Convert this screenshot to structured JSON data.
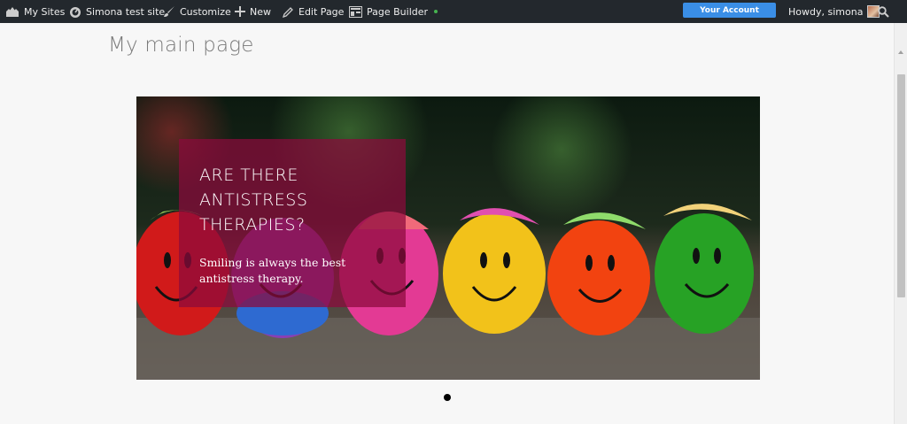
{
  "adminbar": {
    "my_sites": "My Sites",
    "site_name": "Simona test site",
    "customize": "Customize",
    "new": "New",
    "edit_page": "Edit Page",
    "page_builder": "Page Builder",
    "account_button": "Your Account",
    "howdy": "Howdy, simona"
  },
  "page": {
    "title": "My main page"
  },
  "slide": {
    "heading": "ARE THERE ANTISTRESS THERAPIES?",
    "text": "Smiling is always the best antistress therapy."
  },
  "icons": [
    "my-sites-icon",
    "dashboard-icon",
    "brush-icon",
    "plus-icon",
    "pencil-icon",
    "page-builder-icon",
    "search-icon"
  ],
  "colors": {
    "adminbar_bg": "#23282d",
    "account_button": "#3a8ee6",
    "overlay": "#8c0a3c",
    "status_dot": "#46b450"
  }
}
